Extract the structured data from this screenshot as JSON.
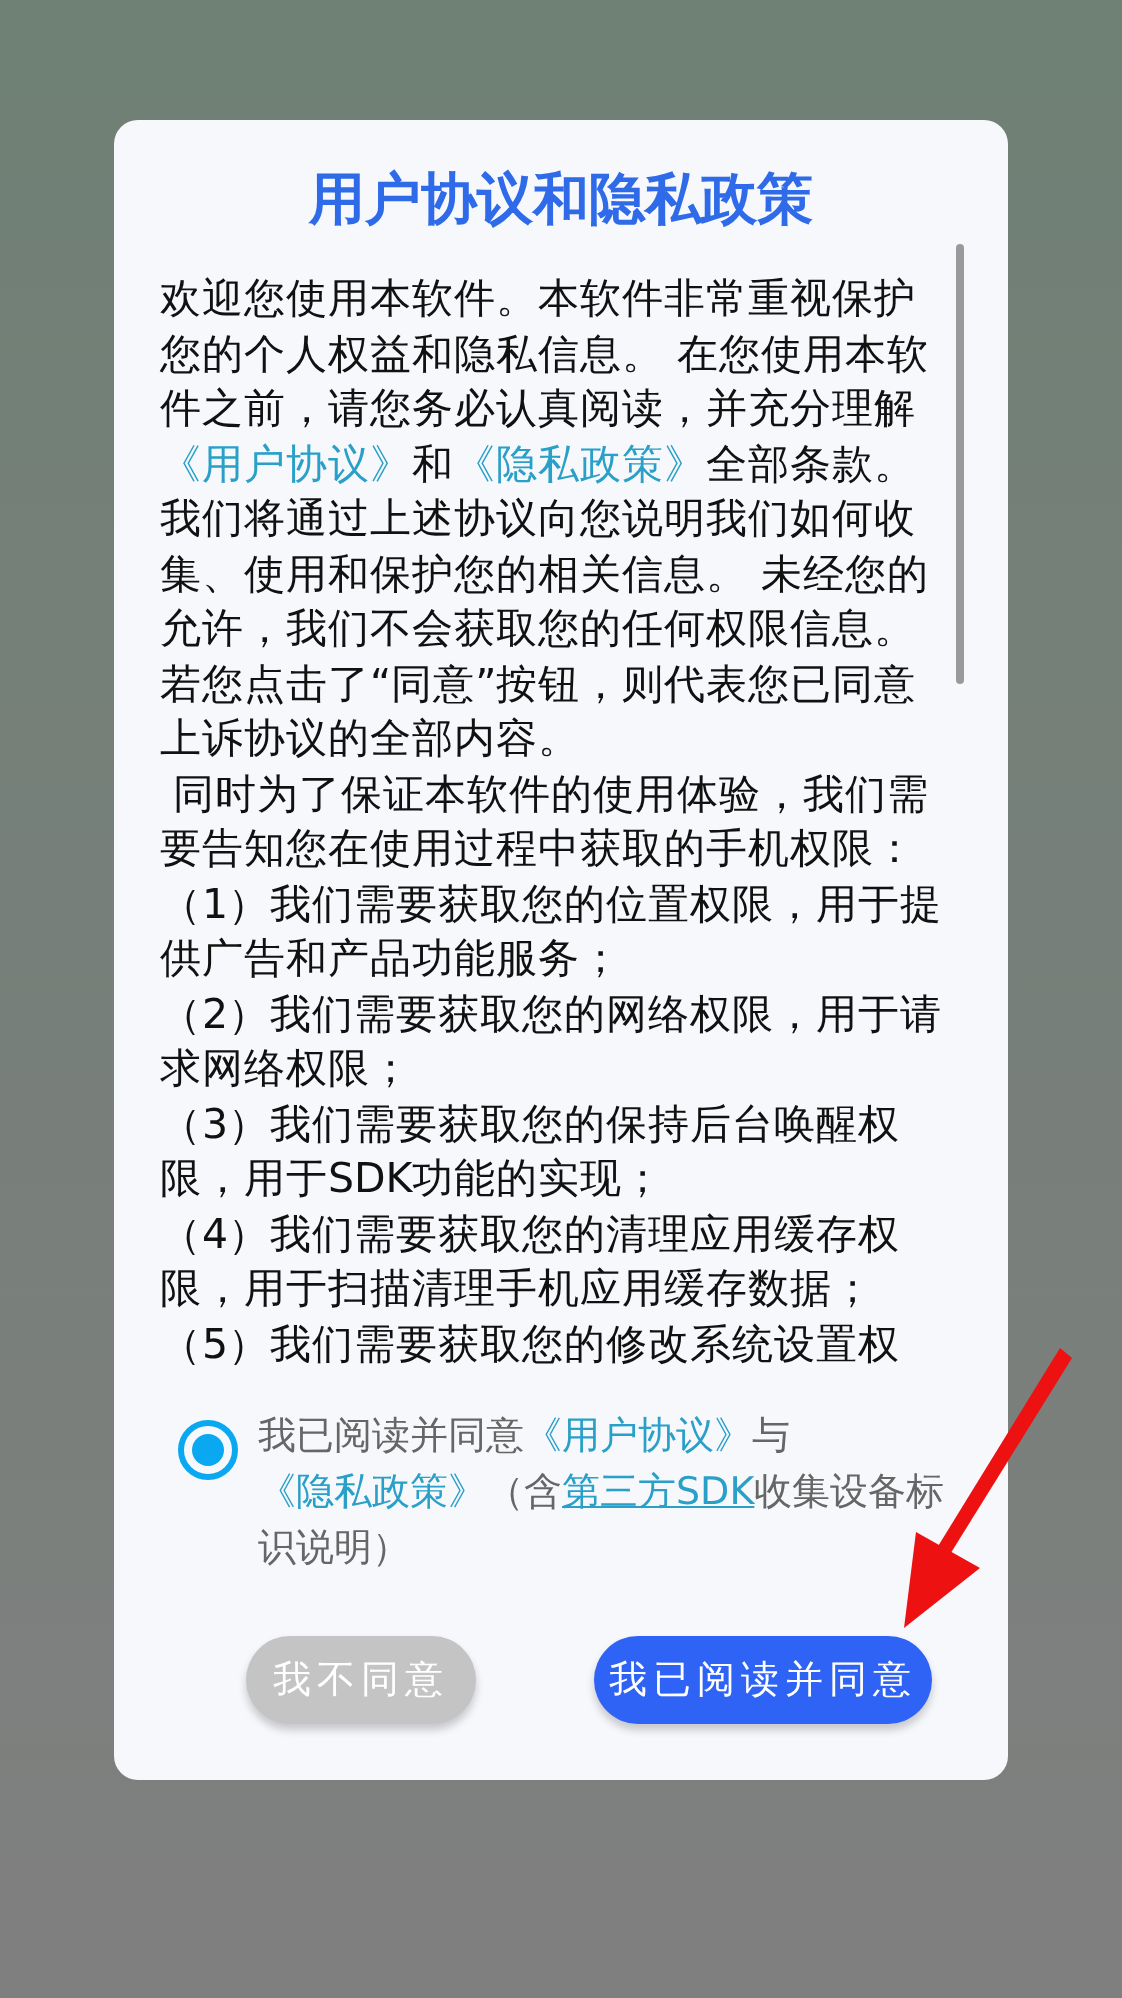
{
  "dialog": {
    "title": "用户协议和隐私政策",
    "paragraphs": [
      {
        "segments": [
          {
            "kind": "text",
            "text": "欢迎您使用本软件。本软件非常重视保护您的个人权益和隐私信息。 在您使用本软件之前，请您务必认真阅读，并充分理解"
          },
          {
            "kind": "link",
            "text": "《用户协议》"
          },
          {
            "kind": "text",
            "text": "和"
          },
          {
            "kind": "link",
            "text": "《隐私政策》"
          },
          {
            "kind": "text",
            "text": "全部条款。我们将通过上述协议向您说明我们如何收集、使用和保护您的相关信息。 未经您的允许，我们不会获取您的任何权限信息。若您点击了“同意”按钮，则代表您已同意上诉协议的全部内容。"
          }
        ]
      },
      {
        "segments": [
          {
            "kind": "text",
            "text": " 同时为了保证本软件的使用体验，我们需要告知您在使用过程中获取的手机权限："
          }
        ]
      },
      {
        "segments": [
          {
            "kind": "text",
            "text": "（1）我们需要获取您的位置权限，用于提供广告和产品功能服务；"
          }
        ]
      },
      {
        "segments": [
          {
            "kind": "text",
            "text": "（2）我们需要获取您的网络权限，用于请求网络权限；"
          }
        ]
      },
      {
        "segments": [
          {
            "kind": "text",
            "text": "（3）我们需要获取您的保持后台唤醒权限，用于SDK功能的实现；"
          }
        ]
      },
      {
        "segments": [
          {
            "kind": "text",
            "text": "（4）我们需要获取您的清理应用缓存权限，用于扫描清理手机应用缓存数据；"
          }
        ]
      },
      {
        "segments": [
          {
            "kind": "text",
            "text": "（5）我们需要获取您的修改系统设置权"
          }
        ]
      }
    ],
    "consent": {
      "checked": true,
      "segments": [
        {
          "kind": "text",
          "text": "我已阅读并同意"
        },
        {
          "kind": "link",
          "text": "《用户协议》"
        },
        {
          "kind": "text",
          "text": "与"
        },
        {
          "kind": "link",
          "text": "《隐私政策》"
        },
        {
          "kind": "text",
          "text": "（含"
        },
        {
          "kind": "underlined_link",
          "text": "第三方SDK"
        },
        {
          "kind": "text",
          "text": "收集设备标识说明）"
        }
      ]
    },
    "buttons": [
      {
        "label": "我不同意",
        "kind": "secondary"
      },
      {
        "label": "我已阅读并同意",
        "kind": "primary"
      }
    ]
  }
}
